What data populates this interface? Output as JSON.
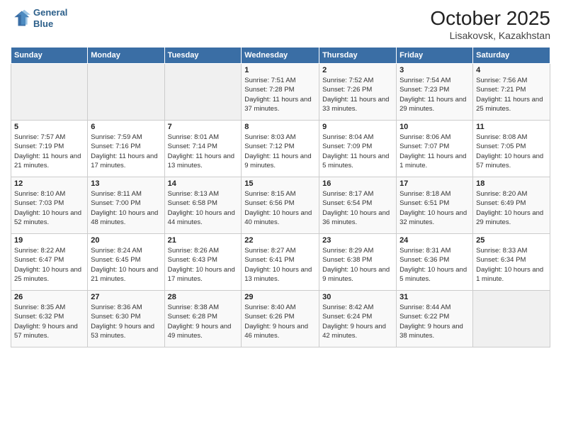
{
  "header": {
    "logo_line1": "General",
    "logo_line2": "Blue",
    "month_title": "October 2025",
    "location": "Lisakovsk, Kazakhstan"
  },
  "days_of_week": [
    "Sunday",
    "Monday",
    "Tuesday",
    "Wednesday",
    "Thursday",
    "Friday",
    "Saturday"
  ],
  "weeks": [
    [
      {
        "day": "",
        "info": ""
      },
      {
        "day": "",
        "info": ""
      },
      {
        "day": "",
        "info": ""
      },
      {
        "day": "1",
        "info": "Sunrise: 7:51 AM\nSunset: 7:28 PM\nDaylight: 11 hours\nand 37 minutes."
      },
      {
        "day": "2",
        "info": "Sunrise: 7:52 AM\nSunset: 7:26 PM\nDaylight: 11 hours\nand 33 minutes."
      },
      {
        "day": "3",
        "info": "Sunrise: 7:54 AM\nSunset: 7:23 PM\nDaylight: 11 hours\nand 29 minutes."
      },
      {
        "day": "4",
        "info": "Sunrise: 7:56 AM\nSunset: 7:21 PM\nDaylight: 11 hours\nand 25 minutes."
      }
    ],
    [
      {
        "day": "5",
        "info": "Sunrise: 7:57 AM\nSunset: 7:19 PM\nDaylight: 11 hours\nand 21 minutes."
      },
      {
        "day": "6",
        "info": "Sunrise: 7:59 AM\nSunset: 7:16 PM\nDaylight: 11 hours\nand 17 minutes."
      },
      {
        "day": "7",
        "info": "Sunrise: 8:01 AM\nSunset: 7:14 PM\nDaylight: 11 hours\nand 13 minutes."
      },
      {
        "day": "8",
        "info": "Sunrise: 8:03 AM\nSunset: 7:12 PM\nDaylight: 11 hours\nand 9 minutes."
      },
      {
        "day": "9",
        "info": "Sunrise: 8:04 AM\nSunset: 7:09 PM\nDaylight: 11 hours\nand 5 minutes."
      },
      {
        "day": "10",
        "info": "Sunrise: 8:06 AM\nSunset: 7:07 PM\nDaylight: 11 hours\nand 1 minute."
      },
      {
        "day": "11",
        "info": "Sunrise: 8:08 AM\nSunset: 7:05 PM\nDaylight: 10 hours\nand 57 minutes."
      }
    ],
    [
      {
        "day": "12",
        "info": "Sunrise: 8:10 AM\nSunset: 7:03 PM\nDaylight: 10 hours\nand 52 minutes."
      },
      {
        "day": "13",
        "info": "Sunrise: 8:11 AM\nSunset: 7:00 PM\nDaylight: 10 hours\nand 48 minutes."
      },
      {
        "day": "14",
        "info": "Sunrise: 8:13 AM\nSunset: 6:58 PM\nDaylight: 10 hours\nand 44 minutes."
      },
      {
        "day": "15",
        "info": "Sunrise: 8:15 AM\nSunset: 6:56 PM\nDaylight: 10 hours\nand 40 minutes."
      },
      {
        "day": "16",
        "info": "Sunrise: 8:17 AM\nSunset: 6:54 PM\nDaylight: 10 hours\nand 36 minutes."
      },
      {
        "day": "17",
        "info": "Sunrise: 8:18 AM\nSunset: 6:51 PM\nDaylight: 10 hours\nand 32 minutes."
      },
      {
        "day": "18",
        "info": "Sunrise: 8:20 AM\nSunset: 6:49 PM\nDaylight: 10 hours\nand 29 minutes."
      }
    ],
    [
      {
        "day": "19",
        "info": "Sunrise: 8:22 AM\nSunset: 6:47 PM\nDaylight: 10 hours\nand 25 minutes."
      },
      {
        "day": "20",
        "info": "Sunrise: 8:24 AM\nSunset: 6:45 PM\nDaylight: 10 hours\nand 21 minutes."
      },
      {
        "day": "21",
        "info": "Sunrise: 8:26 AM\nSunset: 6:43 PM\nDaylight: 10 hours\nand 17 minutes."
      },
      {
        "day": "22",
        "info": "Sunrise: 8:27 AM\nSunset: 6:41 PM\nDaylight: 10 hours\nand 13 minutes."
      },
      {
        "day": "23",
        "info": "Sunrise: 8:29 AM\nSunset: 6:38 PM\nDaylight: 10 hours\nand 9 minutes."
      },
      {
        "day": "24",
        "info": "Sunrise: 8:31 AM\nSunset: 6:36 PM\nDaylight: 10 hours\nand 5 minutes."
      },
      {
        "day": "25",
        "info": "Sunrise: 8:33 AM\nSunset: 6:34 PM\nDaylight: 10 hours\nand 1 minute."
      }
    ],
    [
      {
        "day": "26",
        "info": "Sunrise: 8:35 AM\nSunset: 6:32 PM\nDaylight: 9 hours\nand 57 minutes."
      },
      {
        "day": "27",
        "info": "Sunrise: 8:36 AM\nSunset: 6:30 PM\nDaylight: 9 hours\nand 53 minutes."
      },
      {
        "day": "28",
        "info": "Sunrise: 8:38 AM\nSunset: 6:28 PM\nDaylight: 9 hours\nand 49 minutes."
      },
      {
        "day": "29",
        "info": "Sunrise: 8:40 AM\nSunset: 6:26 PM\nDaylight: 9 hours\nand 46 minutes."
      },
      {
        "day": "30",
        "info": "Sunrise: 8:42 AM\nSunset: 6:24 PM\nDaylight: 9 hours\nand 42 minutes."
      },
      {
        "day": "31",
        "info": "Sunrise: 8:44 AM\nSunset: 6:22 PM\nDaylight: 9 hours\nand 38 minutes."
      },
      {
        "day": "",
        "info": ""
      }
    ]
  ]
}
